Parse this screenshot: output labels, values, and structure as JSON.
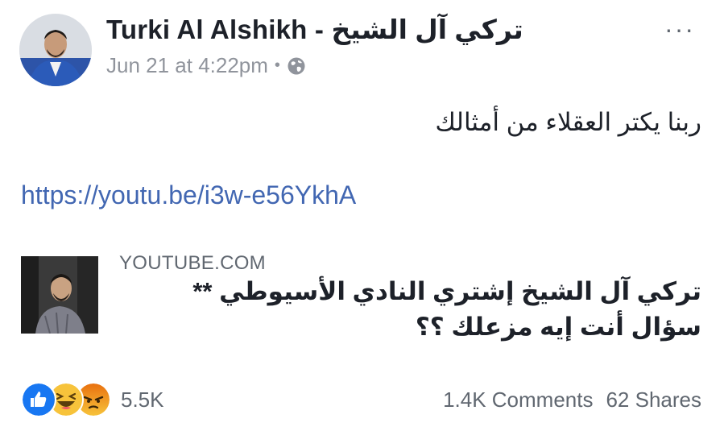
{
  "post": {
    "author": {
      "name": "Turki Al Alshikh - تركي آل الشيخ",
      "avatar_icon": "profile-photo"
    },
    "meta": {
      "timestamp": "Jun 21 at 4:22pm",
      "separator": "•",
      "privacy_icon": "globe-icon"
    },
    "more_label": "···",
    "text": "ربنا يكتر العقلاء من أمثالك",
    "link": "https://youtu.be/i3w-e56YkhA",
    "preview": {
      "domain": "YOUTUBE.COM",
      "title": "تركي آل الشيخ إشتري النادي الأسيوطي ** سؤال أنت إيه مزعلك ؟؟",
      "thumbnail_icon": "video-thumbnail"
    },
    "reactions": {
      "icons": [
        "like-icon",
        "haha-icon",
        "angry-icon"
      ],
      "count": "5.5K"
    },
    "counts": {
      "comments": "1.4K Comments",
      "shares": "62 Shares"
    }
  },
  "colors": {
    "link": "#4267b2",
    "secondary_text": "#90949c",
    "like_blue": "#1877f2",
    "haha_yellow": "#f7c33b",
    "angry_orange": "#e9710f"
  }
}
